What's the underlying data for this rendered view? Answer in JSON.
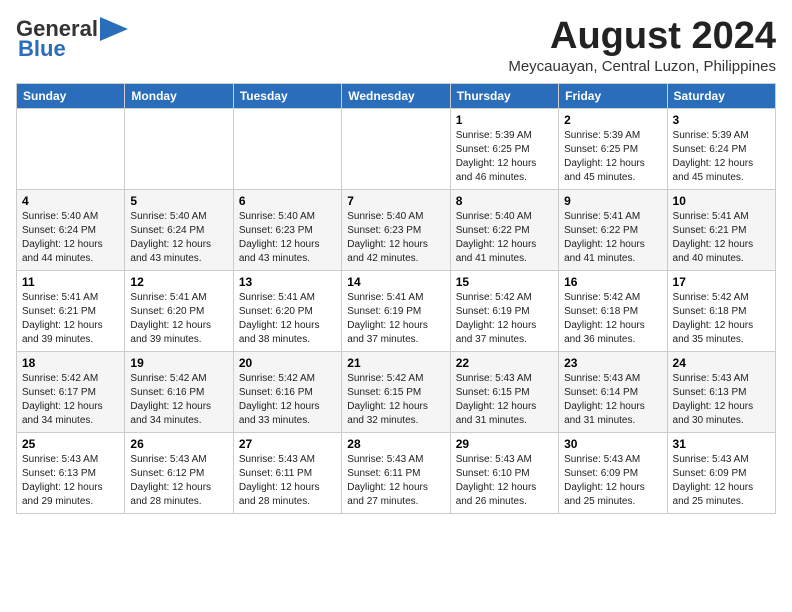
{
  "logo": {
    "general": "General",
    "blue": "Blue",
    "arrow_unicode": "▶"
  },
  "header": {
    "month_year": "August 2024",
    "location": "Meycauayan, Central Luzon, Philippines"
  },
  "weekdays": [
    "Sunday",
    "Monday",
    "Tuesday",
    "Wednesday",
    "Thursday",
    "Friday",
    "Saturday"
  ],
  "weeks": [
    [
      {
        "day": "",
        "detail": ""
      },
      {
        "day": "",
        "detail": ""
      },
      {
        "day": "",
        "detail": ""
      },
      {
        "day": "",
        "detail": ""
      },
      {
        "day": "1",
        "detail": "Sunrise: 5:39 AM\nSunset: 6:25 PM\nDaylight: 12 hours\nand 46 minutes."
      },
      {
        "day": "2",
        "detail": "Sunrise: 5:39 AM\nSunset: 6:25 PM\nDaylight: 12 hours\nand 45 minutes."
      },
      {
        "day": "3",
        "detail": "Sunrise: 5:39 AM\nSunset: 6:24 PM\nDaylight: 12 hours\nand 45 minutes."
      }
    ],
    [
      {
        "day": "4",
        "detail": "Sunrise: 5:40 AM\nSunset: 6:24 PM\nDaylight: 12 hours\nand 44 minutes."
      },
      {
        "day": "5",
        "detail": "Sunrise: 5:40 AM\nSunset: 6:24 PM\nDaylight: 12 hours\nand 43 minutes."
      },
      {
        "day": "6",
        "detail": "Sunrise: 5:40 AM\nSunset: 6:23 PM\nDaylight: 12 hours\nand 43 minutes."
      },
      {
        "day": "7",
        "detail": "Sunrise: 5:40 AM\nSunset: 6:23 PM\nDaylight: 12 hours\nand 42 minutes."
      },
      {
        "day": "8",
        "detail": "Sunrise: 5:40 AM\nSunset: 6:22 PM\nDaylight: 12 hours\nand 41 minutes."
      },
      {
        "day": "9",
        "detail": "Sunrise: 5:41 AM\nSunset: 6:22 PM\nDaylight: 12 hours\nand 41 minutes."
      },
      {
        "day": "10",
        "detail": "Sunrise: 5:41 AM\nSunset: 6:21 PM\nDaylight: 12 hours\nand 40 minutes."
      }
    ],
    [
      {
        "day": "11",
        "detail": "Sunrise: 5:41 AM\nSunset: 6:21 PM\nDaylight: 12 hours\nand 39 minutes."
      },
      {
        "day": "12",
        "detail": "Sunrise: 5:41 AM\nSunset: 6:20 PM\nDaylight: 12 hours\nand 39 minutes."
      },
      {
        "day": "13",
        "detail": "Sunrise: 5:41 AM\nSunset: 6:20 PM\nDaylight: 12 hours\nand 38 minutes."
      },
      {
        "day": "14",
        "detail": "Sunrise: 5:41 AM\nSunset: 6:19 PM\nDaylight: 12 hours\nand 37 minutes."
      },
      {
        "day": "15",
        "detail": "Sunrise: 5:42 AM\nSunset: 6:19 PM\nDaylight: 12 hours\nand 37 minutes."
      },
      {
        "day": "16",
        "detail": "Sunrise: 5:42 AM\nSunset: 6:18 PM\nDaylight: 12 hours\nand 36 minutes."
      },
      {
        "day": "17",
        "detail": "Sunrise: 5:42 AM\nSunset: 6:18 PM\nDaylight: 12 hours\nand 35 minutes."
      }
    ],
    [
      {
        "day": "18",
        "detail": "Sunrise: 5:42 AM\nSunset: 6:17 PM\nDaylight: 12 hours\nand 34 minutes."
      },
      {
        "day": "19",
        "detail": "Sunrise: 5:42 AM\nSunset: 6:16 PM\nDaylight: 12 hours\nand 34 minutes."
      },
      {
        "day": "20",
        "detail": "Sunrise: 5:42 AM\nSunset: 6:16 PM\nDaylight: 12 hours\nand 33 minutes."
      },
      {
        "day": "21",
        "detail": "Sunrise: 5:42 AM\nSunset: 6:15 PM\nDaylight: 12 hours\nand 32 minutes."
      },
      {
        "day": "22",
        "detail": "Sunrise: 5:43 AM\nSunset: 6:15 PM\nDaylight: 12 hours\nand 31 minutes."
      },
      {
        "day": "23",
        "detail": "Sunrise: 5:43 AM\nSunset: 6:14 PM\nDaylight: 12 hours\nand 31 minutes."
      },
      {
        "day": "24",
        "detail": "Sunrise: 5:43 AM\nSunset: 6:13 PM\nDaylight: 12 hours\nand 30 minutes."
      }
    ],
    [
      {
        "day": "25",
        "detail": "Sunrise: 5:43 AM\nSunset: 6:13 PM\nDaylight: 12 hours\nand 29 minutes."
      },
      {
        "day": "26",
        "detail": "Sunrise: 5:43 AM\nSunset: 6:12 PM\nDaylight: 12 hours\nand 28 minutes."
      },
      {
        "day": "27",
        "detail": "Sunrise: 5:43 AM\nSunset: 6:11 PM\nDaylight: 12 hours\nand 28 minutes."
      },
      {
        "day": "28",
        "detail": "Sunrise: 5:43 AM\nSunset: 6:11 PM\nDaylight: 12 hours\nand 27 minutes."
      },
      {
        "day": "29",
        "detail": "Sunrise: 5:43 AM\nSunset: 6:10 PM\nDaylight: 12 hours\nand 26 minutes."
      },
      {
        "day": "30",
        "detail": "Sunrise: 5:43 AM\nSunset: 6:09 PM\nDaylight: 12 hours\nand 25 minutes."
      },
      {
        "day": "31",
        "detail": "Sunrise: 5:43 AM\nSunset: 6:09 PM\nDaylight: 12 hours\nand 25 minutes."
      }
    ]
  ]
}
